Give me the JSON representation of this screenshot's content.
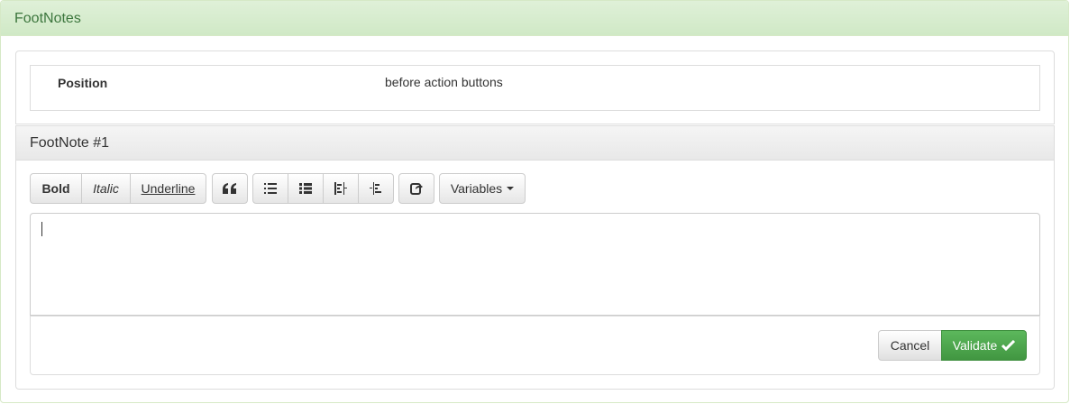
{
  "header": {
    "title": "FootNotes"
  },
  "position": {
    "label": "Position",
    "value": "before action buttons"
  },
  "footnote": {
    "title": "FootNote #1"
  },
  "toolbar": {
    "bold_label": "Bold",
    "italic_label": "Italic",
    "underline_label": "Underline",
    "quote_icon": "quote-icon",
    "unordered_list_icon": "unordered-list-icon",
    "ordered_list_icon": "ordered-list-icon",
    "outdent_icon": "outdent-icon",
    "indent_icon": "indent-icon",
    "link_icon": "share-icon",
    "variables_label": "Variables"
  },
  "editor": {
    "value": ""
  },
  "actions": {
    "cancel_label": "Cancel",
    "validate_label": "Validate"
  },
  "colors": {
    "header_bg": "#dff0d8",
    "header_text": "#3c763d",
    "validate_bg": "#5cb85c"
  }
}
